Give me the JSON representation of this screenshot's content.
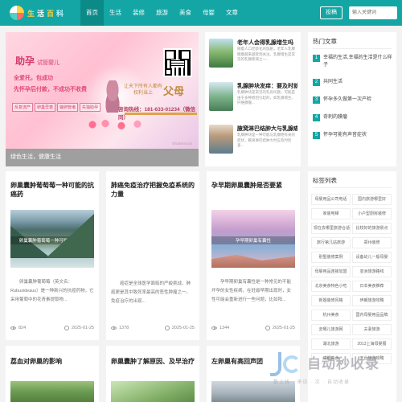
{
  "logo": {
    "chars": [
      "生",
      "活",
      "百",
      "科"
    ]
  },
  "nav": {
    "items": [
      "首页",
      "生活",
      "装修",
      "旅游",
      "美食",
      "母婴",
      "文章"
    ],
    "active_index": 0
  },
  "header": {
    "login_label": "投稿",
    "search_placeholder": "输入关键词"
  },
  "banner": {
    "title": "助孕",
    "title_small": "试管婴儿",
    "lines": [
      "全爱托，包成功",
      "先怀孕后付款，不成功不收费"
    ],
    "tags": [
      "反复流产",
      "卵巢早衰",
      "输卵管堵",
      "失独助孕"
    ],
    "slogan": "让天下所有人都有权利当上",
    "parents": "父母",
    "phone": "咨询热线：181-633-01234（微信同）",
    "watermark": "Shutterstock",
    "caption": "绿色生活，健康生活"
  },
  "mid_list": [
    {
      "title": "老年人会得乳腺增生吗",
      "summary": "随着人口老龄化的加剧，老年人乳腺健康越来越受到关注。乳腺增生是常见的乳腺疾病之一..."
    },
    {
      "title": "乳腺肿块发痒：要及时就医",
      "summary": "乳腺肿块是常见的乳房问题，可能是由于多种原因引起的，如乳腺增生、纤维腺瘤..."
    },
    {
      "title": "腋窝淋巴结肿大与乳腺癌",
      "summary": "乳腺肿块是一种可能与乳腺癌有关的症状，腋窝淋巴结肿大时应及时检查..."
    }
  ],
  "hot": {
    "title": "热门文章",
    "items": [
      "幸福的生活,幸福的生活是什么样子",
      "共同生活",
      "怀孕多久做第一次产检",
      "奇刺的膜瘤",
      "怀孕可能有声音症状"
    ]
  },
  "cards": [
    {
      "title": "卵巢囊肿葡萄莓一种可能的抗癌药",
      "image_caption": "卵巢囊肿葡萄莓一种可能的抗癌药",
      "summary": "卵巢囊肿葡萄莓（英文名：Rubusideaus）是一种新兴的抗癌药物，它采用葡萄中的花青素提取物...",
      "views": "824",
      "date": "2025-01-25"
    },
    {
      "title": "肺癌免疫治疗把握免疫系统的力量",
      "image_caption": "",
      "summary": "癌症是全球医学面临的严峻挑战，肺癌更是其中致死率最高的恶性肿瘤之一。免疫治疗的出现...",
      "views": "1378",
      "date": "2025-01-25"
    },
    {
      "title": "孕早期卵巢囊肿是否要紧",
      "image_caption": "孕早期卵巢有囊性",
      "summary": "孕早期卵巢有囊性是一种常见的不能坏孕的女性疾病，在妊娠早期出现时，女性可能会重新进行一些问题，比如阳...",
      "views": "1344",
      "date": "2025-01-25"
    }
  ],
  "tags_box": {
    "title": "标签列表",
    "tags": [
      "母婴用品公司电话",
      "国内旅游哪里好",
      "家装电梯",
      "小户型厨房装修",
      "现在去哪里旅游合适",
      "比较好的旅游景点",
      "旅行第几站旅游",
      "郑州装修",
      "别墅装修案例",
      "设备幼儿一般母婴",
      "母婴用品连锁加盟",
      "亚洲旅游路线",
      "北京美食特色小吃",
      "日本美食推荐",
      "新婚装修风格",
      "伊朗旅游攻略",
      "杭州美食",
      "国内母婴用品品牌",
      "去哪儿旅游网",
      "夫妻旅游",
      "湖北旅游",
      "2013上海母婴展",
      "成都美食",
      "天台旅游攻略"
    ]
  },
  "bottom_cards": [
    {
      "title": "荔血对卵巢的影响"
    },
    {
      "title": "卵巢囊肿了解原因、及早治疗"
    },
    {
      "title": "左卵巢有高回声团"
    }
  ],
  "watermark": {
    "text": "自动秒收录",
    "subtitle": "数上线 · 来访 · 次 · 自动收录"
  }
}
